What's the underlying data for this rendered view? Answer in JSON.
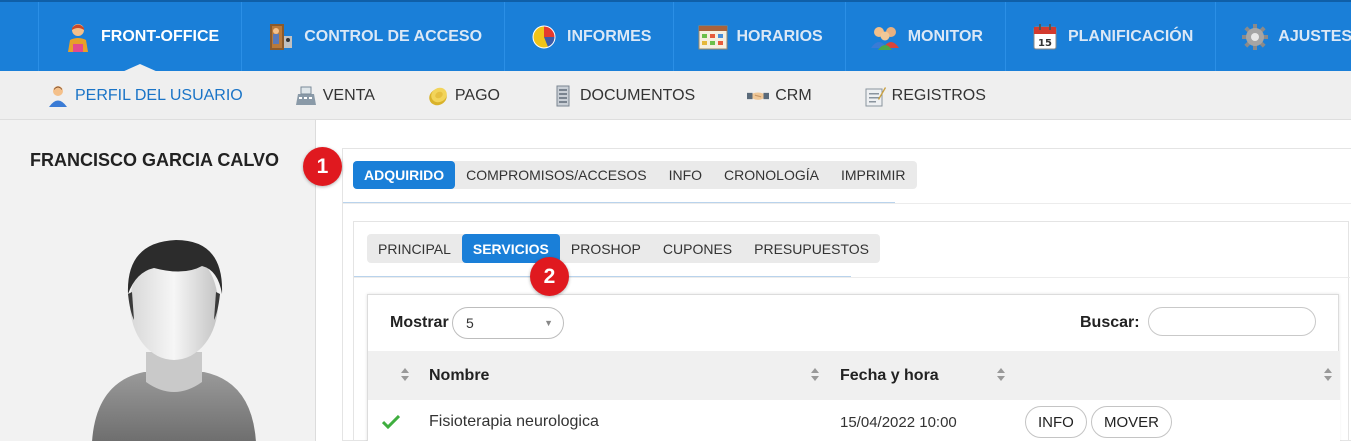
{
  "topnav": {
    "items": [
      {
        "label": "FRONT-OFFICE",
        "icon": "receptionist-icon",
        "active": true
      },
      {
        "label": "CONTROL DE ACCESO",
        "icon": "door-access-icon"
      },
      {
        "label": "INFORMES",
        "icon": "pie-chart-icon"
      },
      {
        "label": "HORARIOS",
        "icon": "schedule-grid-icon"
      },
      {
        "label": "MONITOR",
        "icon": "users-group-icon"
      },
      {
        "label": "PLANIFICACIÓN",
        "icon": "calendar-icon"
      },
      {
        "label": "AJUSTES",
        "icon": "gear-icon"
      }
    ]
  },
  "subnav": {
    "items": [
      {
        "label": "PERFIL DEL USUARIO",
        "icon": "user-profile-icon",
        "active": true
      },
      {
        "label": "VENTA",
        "icon": "cash-register-icon"
      },
      {
        "label": "PAGO",
        "icon": "coin-icon"
      },
      {
        "label": "DOCUMENTOS",
        "icon": "document-icon"
      },
      {
        "label": "CRM",
        "icon": "handshake-icon"
      },
      {
        "label": "REGISTROS",
        "icon": "notepad-icon"
      }
    ]
  },
  "user": {
    "name": "FRANCISCO GARCIA CALVO"
  },
  "tabs_main": [
    {
      "label": "ADQUIRIDO",
      "active": true
    },
    {
      "label": "COMPROMISOS/ACCESOS"
    },
    {
      "label": "INFO"
    },
    {
      "label": "CRONOLOGÍA"
    },
    {
      "label": "IMPRIMIR"
    }
  ],
  "tabs_sub": [
    {
      "label": "PRINCIPAL"
    },
    {
      "label": "SERVICIOS",
      "active": true
    },
    {
      "label": "PROSHOP"
    },
    {
      "label": "CUPONES"
    },
    {
      "label": "PRESUPUESTOS"
    }
  ],
  "table": {
    "show_label": "Mostrar",
    "show_value": "5",
    "search_label": "Buscar:",
    "search_value": "",
    "columns": [
      "Nombre",
      "Fecha y hora"
    ],
    "rows": [
      {
        "status": "check-icon",
        "name": "Fisioterapia neurologica",
        "datetime": "15/04/2022 10:00",
        "actions": [
          "INFO",
          "MOVER"
        ]
      }
    ]
  },
  "callouts": [
    "1",
    "2"
  ],
  "colors": {
    "primary": "#1a7fd8",
    "callout": "#e0191f",
    "check": "#3fae3f"
  }
}
